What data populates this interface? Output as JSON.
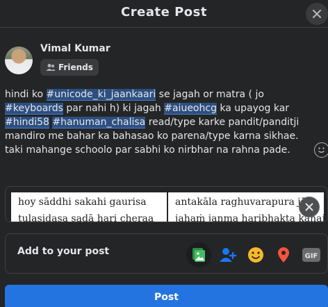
{
  "header": {
    "title": "Create Post"
  },
  "user": {
    "name": "Vimal Kumar",
    "audience": "Friends"
  },
  "post": {
    "segments": [
      {
        "t": "hindi ko ",
        "tag": false
      },
      {
        "t": "#unicode_ki_jaankaari",
        "tag": true
      },
      {
        "t": " se jagah or matra ( jo ",
        "tag": false
      },
      {
        "t": "#keyboards",
        "tag": true
      },
      {
        "t": " par nahi h) ki jagah ",
        "tag": false
      },
      {
        "t": "#aiueohcg",
        "tag": true
      },
      {
        "t": " ka upayog kar ",
        "tag": false
      },
      {
        "t": "#hindi58",
        "tag": true
      },
      {
        "t": " ",
        "tag": false
      },
      {
        "t": "#hanuman_chalisa",
        "tag": true
      },
      {
        "t": " read/type karke pandit/panditji mandiro me bahar ka bahasao ko parena/type karna sikhae. taki mahange schoolo par sabhi ko nirbhar na rahna pade.",
        "tag": false
      }
    ]
  },
  "preview": {
    "left_line1": "hoy sāddhi sakahi gaurisa",
    "left_line2": "tulasidasa sadā hari cheraa",
    "right_line1": "antakāla raghuvarapura jāi",
    "right_line2": "jahaṁ janma haribhakta kahai"
  },
  "add_bar": {
    "label": "Add to your post"
  },
  "tools": [
    {
      "name": "photo-video-icon",
      "color": "#45bd62"
    },
    {
      "name": "tag-people-icon",
      "color": "#1877f2"
    },
    {
      "name": "feeling-icon",
      "color": "#f7b928"
    },
    {
      "name": "check-in-icon",
      "color": "#f5533d"
    },
    {
      "name": "gif-icon",
      "color": "#b0b3b8",
      "label": "GIF"
    }
  ],
  "footer": {
    "post_label": "Post"
  }
}
